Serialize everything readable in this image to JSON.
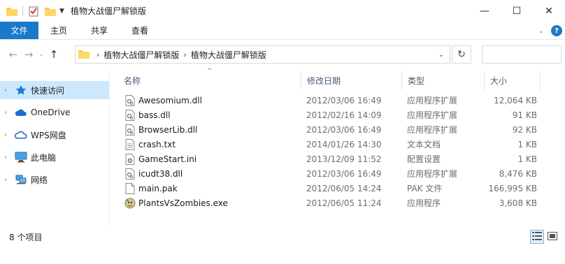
{
  "window": {
    "title": "植物大战僵尸解锁版",
    "minimize_icon": "—",
    "maximize_icon": "☐",
    "close_icon": "✕"
  },
  "ribbon": {
    "tabs": [
      "文件",
      "主页",
      "共享",
      "查看"
    ],
    "help_label": "?"
  },
  "address": {
    "crumbs": [
      "植物大战僵尸解锁版",
      "植物大战僵尸解锁版"
    ],
    "search_placeholder": ""
  },
  "nav": {
    "items": [
      {
        "label": "快速访问",
        "icon": "star-icon"
      },
      {
        "label": "OneDrive",
        "icon": "cloud-icon"
      },
      {
        "label": "WPS网盘",
        "icon": "wps-cloud-icon"
      },
      {
        "label": "此电脑",
        "icon": "computer-icon"
      },
      {
        "label": "网络",
        "icon": "network-icon"
      }
    ]
  },
  "columns": {
    "name": "名称",
    "date": "修改日期",
    "type": "类型",
    "size": "大小"
  },
  "files": [
    {
      "name": "Awesomium.dll",
      "date": "2012/03/06 16:49",
      "type": "应用程序扩展",
      "size": "12,064 KB",
      "icon": "dll-file-icon"
    },
    {
      "name": "bass.dll",
      "date": "2012/02/16 14:09",
      "type": "应用程序扩展",
      "size": "91 KB",
      "icon": "dll-file-icon"
    },
    {
      "name": "BrowserLib.dll",
      "date": "2012/03/06 16:49",
      "type": "应用程序扩展",
      "size": "92 KB",
      "icon": "dll-file-icon"
    },
    {
      "name": "crash.txt",
      "date": "2014/01/26 14:30",
      "type": "文本文档",
      "size": "1 KB",
      "icon": "text-file-icon"
    },
    {
      "name": "GameStart.ini",
      "date": "2013/12/09 11:52",
      "type": "配置设置",
      "size": "1 KB",
      "icon": "ini-file-icon"
    },
    {
      "name": "icudt38.dll",
      "date": "2012/03/06 16:49",
      "type": "应用程序扩展",
      "size": "8,476 KB",
      "icon": "dll-file-icon"
    },
    {
      "name": "main.pak",
      "date": "2012/06/05 14:24",
      "type": "PAK 文件",
      "size": "166,995 KB",
      "icon": "blank-file-icon"
    },
    {
      "name": "PlantsVsZombies.exe",
      "date": "2012/06/05 11:24",
      "type": "应用程序",
      "size": "3,608 KB",
      "icon": "exe-app-icon"
    }
  ],
  "status": {
    "count": "8 个项目"
  }
}
